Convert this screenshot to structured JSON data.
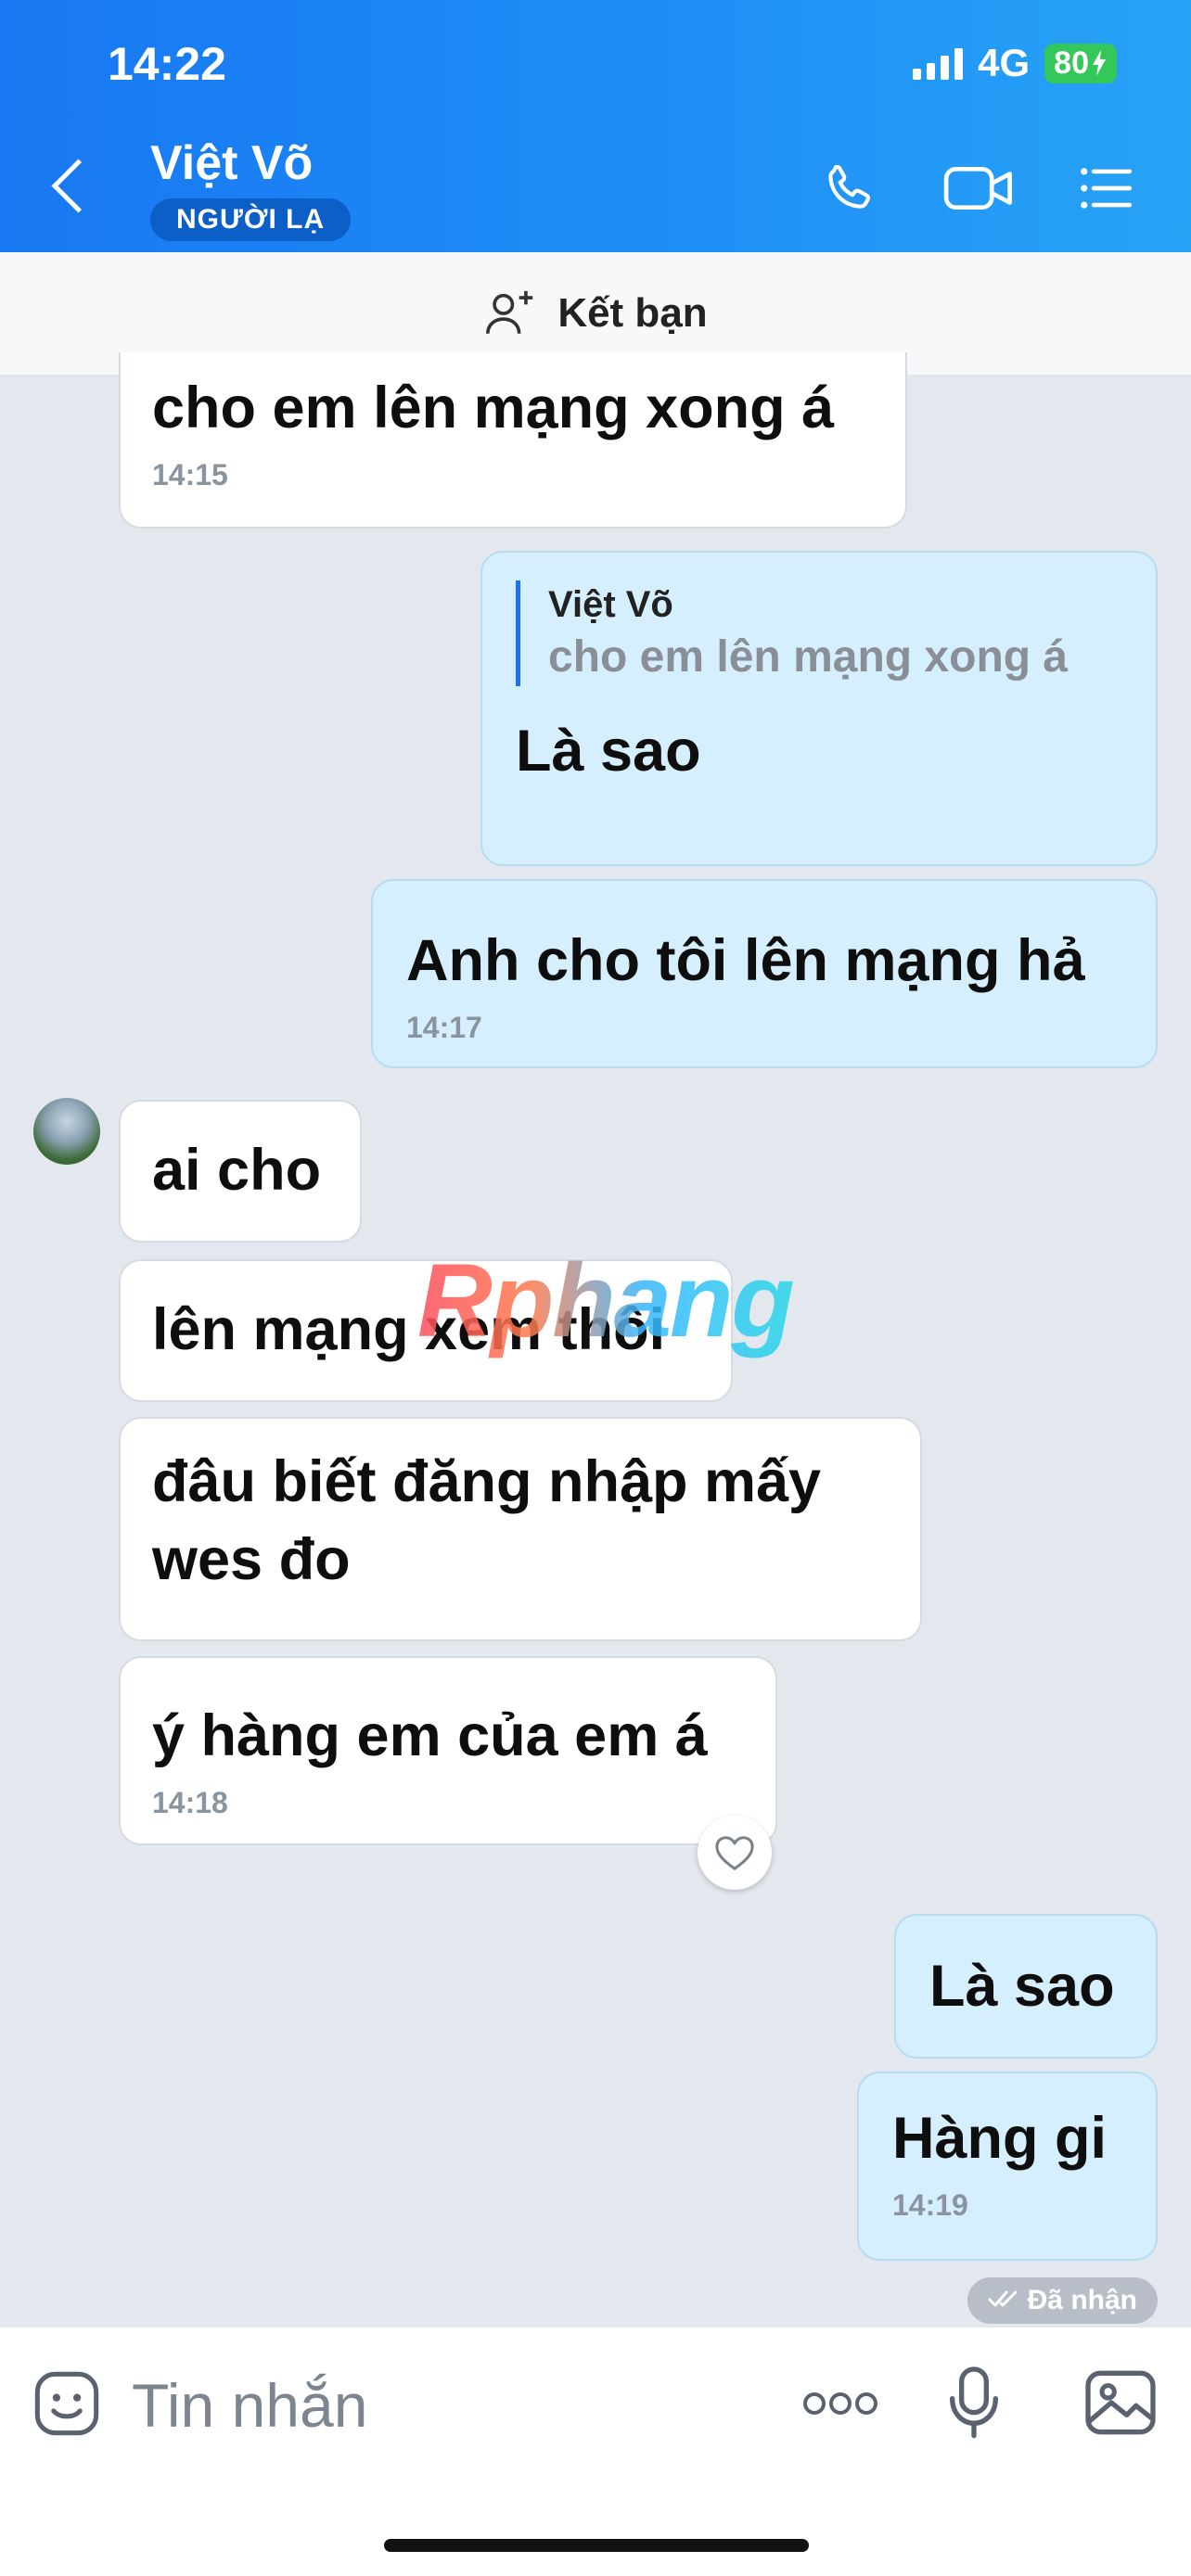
{
  "status_bar": {
    "time": "14:22",
    "network": "4G",
    "battery": "80"
  },
  "header": {
    "contact_name": "Việt Võ",
    "badge": "NGƯỜI LẠ"
  },
  "friend_bar": {
    "label": "Kết bạn"
  },
  "messages": [
    {
      "text": "cho em lên mạng xong á",
      "time": "14:15"
    },
    {
      "quote_name": "Việt Võ",
      "quote_text": "cho em lên mạng xong á",
      "text": "Là sao"
    },
    {
      "text": "Anh cho tôi lên mạng hả",
      "time": "14:17"
    },
    {
      "text": "ai cho"
    },
    {
      "text": "lên mạng xem thôi"
    },
    {
      "text": "đâu biết đăng nhập mấy wes đo"
    },
    {
      "text": "ý hàng em của em á",
      "time": "14:18"
    },
    {
      "text": "Là sao"
    },
    {
      "text": "Hàng gi",
      "time": "14:19"
    }
  ],
  "received_status": "Đã nhận",
  "watermark": "Rphang",
  "input": {
    "placeholder": "Tin nhắn"
  }
}
